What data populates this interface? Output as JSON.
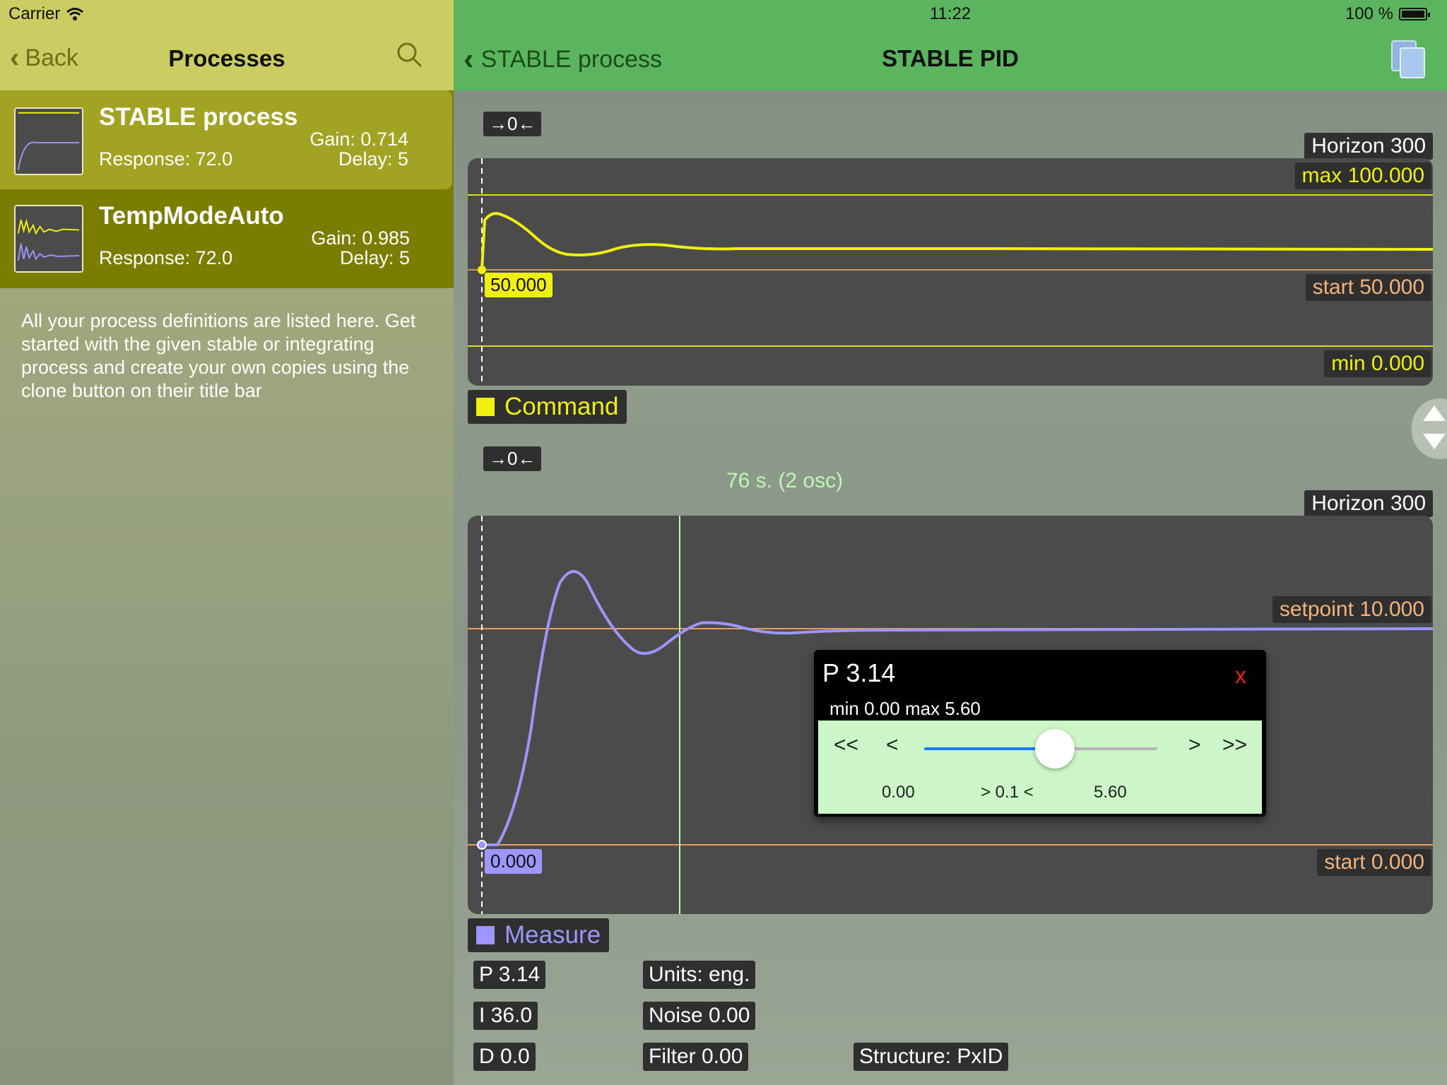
{
  "status": {
    "carrier": "Carrier",
    "time": "11:22",
    "battery": "100 %"
  },
  "left": {
    "back_label": "Back",
    "title": "Processes",
    "items": [
      {
        "name": "STABLE process",
        "response": "Response: 72.0",
        "gain": "Gain: 0.714",
        "delay": "Delay: 5"
      },
      {
        "name": "TempModeAuto",
        "response": "Response: 72.0",
        "gain": "Gain: 0.985",
        "delay": "Delay: 5"
      }
    ],
    "help_text": "All your process definitions are listed here. Get started with the given stable or integrating process and create your own copies using the clone button on their title bar"
  },
  "right": {
    "back_label": "STABLE process",
    "title": "STABLE PID"
  },
  "command_chart": {
    "zero_button": "→0←",
    "horizon": "Horizon 300",
    "max": "max 100.000",
    "start": "start 50.000",
    "min": "min 0.000",
    "cursor_value": "50.000",
    "legend": "Command",
    "color": "#f0f010"
  },
  "measure_chart": {
    "zero_button": "→0←",
    "horizon": "Horizon 300",
    "annotation": "76 s. (2 osc)",
    "setpoint": "setpoint 10.000",
    "start": "start 0.000",
    "cursor_value": "0.000",
    "legend": "Measure",
    "color": "#9d96ff"
  },
  "params": {
    "p": "P 3.14",
    "i": "I 36.0",
    "d": "D 0.0",
    "units": "Units: eng.",
    "noise": "Noise 0.00",
    "filter": "Filter 0.00",
    "structure": "Structure: PxID"
  },
  "popup": {
    "title": "P 3.14",
    "close": "x",
    "range": "min 0.00  max 5.60",
    "btn_first": "<<",
    "btn_prev": "<",
    "btn_next": ">",
    "btn_last": ">>",
    "val_min": "0.00",
    "val_step": "> 0.1 <",
    "val_max": "5.60",
    "slider_fraction": 0.56
  }
}
